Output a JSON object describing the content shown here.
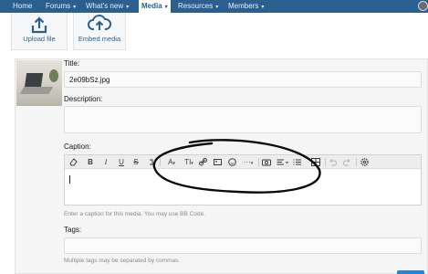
{
  "nav": {
    "items": [
      {
        "label": "Home",
        "caret": ""
      },
      {
        "label": "Forums",
        "caret": "▾"
      },
      {
        "label": "What's new",
        "caret": "▾"
      },
      {
        "label": "Media",
        "caret": "▾"
      },
      {
        "label": "Resources",
        "caret": "▾"
      },
      {
        "label": "Members",
        "caret": "▾"
      }
    ]
  },
  "actions": {
    "upload_label": "Upload file",
    "embed_label": "Embed media"
  },
  "form": {
    "title_label": "Title:",
    "title_value": "2e09bSz.jpg",
    "description_label": "Description:",
    "caption_label": "Caption:",
    "caption_hint": "Enter a caption for this media. You may use BB Code.",
    "tags_label": "Tags:",
    "tags_hint": "Multiple tags may be separated by commas."
  },
  "toolbar": {
    "bold": "B",
    "italic": "I",
    "underline": "U",
    "strike": "S",
    "font_color": "A",
    "font_size": "TI",
    "more": "···"
  },
  "colors": {
    "nav_bg": "#2b5f8f",
    "accent": "#2b83d0"
  },
  "icons": [
    "upload-icon",
    "embed-icon",
    "eraser-icon",
    "link-icon",
    "image-icon",
    "smiley-icon",
    "camera-icon",
    "align-icon",
    "list-icon",
    "table-icon",
    "undo-icon",
    "redo-icon",
    "settings-icon"
  ]
}
